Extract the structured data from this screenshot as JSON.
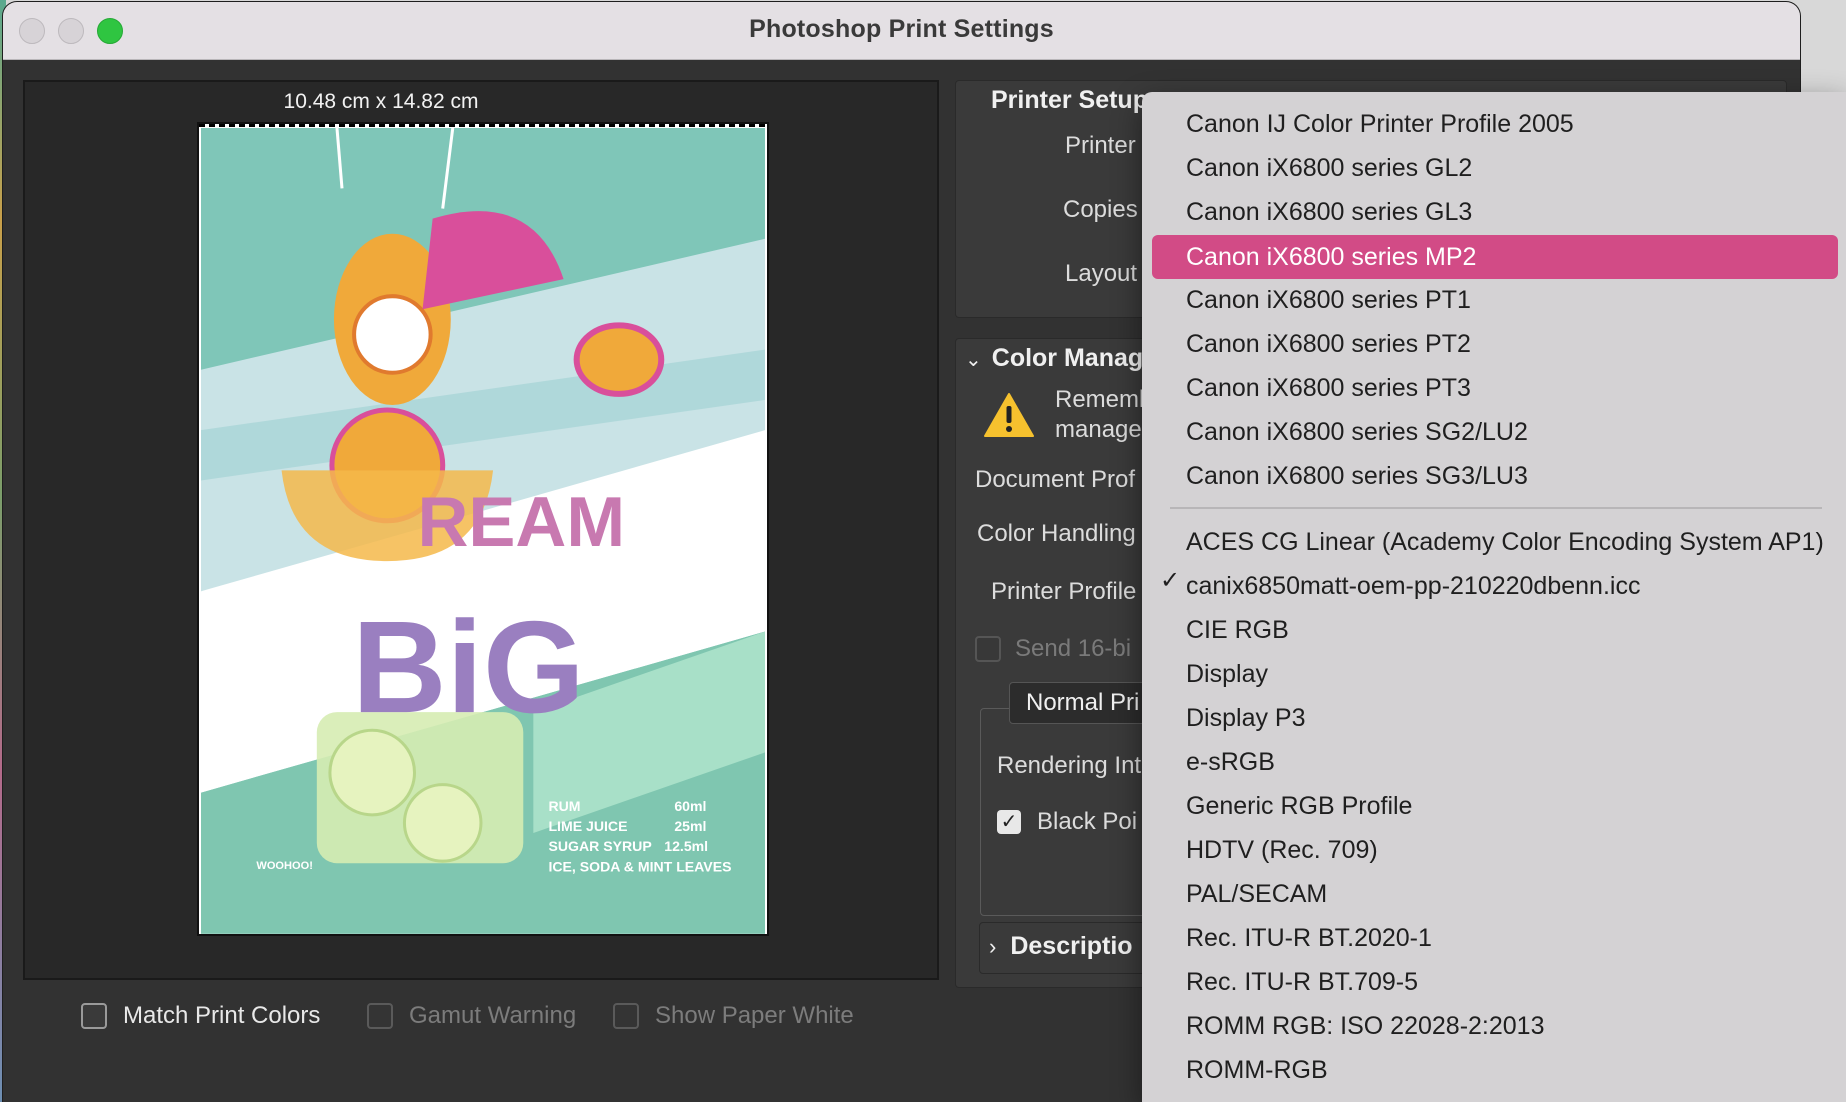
{
  "window": {
    "title": "Photoshop Print Settings"
  },
  "preview": {
    "dimensions": "10.48 cm x 14.82 cm",
    "poster": {
      "line1": "REAM",
      "line2": "BiG",
      "recipe": [
        {
          "item": "RUM",
          "qty": "60ml"
        },
        {
          "item": "LIME JUICE",
          "qty": "25ml"
        },
        {
          "item": "SUGAR SYRUP",
          "qty": "12.5ml"
        },
        {
          "item": "ICE, SODA & MINT LEAVES",
          "qty": ""
        }
      ],
      "brand": "WOOHOO!"
    }
  },
  "bottom_options": {
    "match_print_colors": "Match Print Colors",
    "gamut_warning": "Gamut Warning",
    "show_paper_white": "Show Paper White"
  },
  "settings": {
    "printer_setup": "Printer Setup",
    "printer": "Printer",
    "copies": "Copies",
    "layout": "Layout",
    "color_management": "Color Manag",
    "remember_line1": "Rememl",
    "remember_line2": "manage",
    "document_profile": "Document Prof",
    "color_handling": "Color Handling",
    "printer_profile": "Printer Profile",
    "send_16bit": "Send 16-bi",
    "normal_printing": "Normal Pri",
    "rendering_intent": "Rendering Int",
    "black_point": "Black Poi",
    "description": "Descriptio"
  },
  "profile_menu": {
    "items_top": [
      "Canon IJ Color Printer Profile 2005",
      "Canon iX6800 series GL2",
      "Canon iX6800 series GL3",
      "Canon iX6800 series MP2",
      "Canon iX6800 series PT1",
      "Canon iX6800 series PT2",
      "Canon iX6800 series PT3",
      "Canon iX6800 series SG2/LU2",
      "Canon iX6800 series SG3/LU3"
    ],
    "items_bottom": [
      "ACES CG Linear (Academy Color Encoding System AP1)",
      "canix6850matt-oem-pp-210220dbenn.icc",
      "CIE RGB",
      "Display",
      "Display P3",
      "e-sRGB",
      "Generic RGB Profile",
      "HDTV (Rec. 709)",
      "PAL/SECAM",
      "Rec. ITU-R BT.2020-1",
      "Rec. ITU-R BT.709-5",
      "ROMM RGB: ISO 22028-2:2013",
      "ROMM-RGB"
    ],
    "highlighted": "Canon iX6800 series MP2",
    "checked": "canix6850matt-oem-pp-210220dbenn.icc",
    "highlight_color": "#d24b86"
  }
}
